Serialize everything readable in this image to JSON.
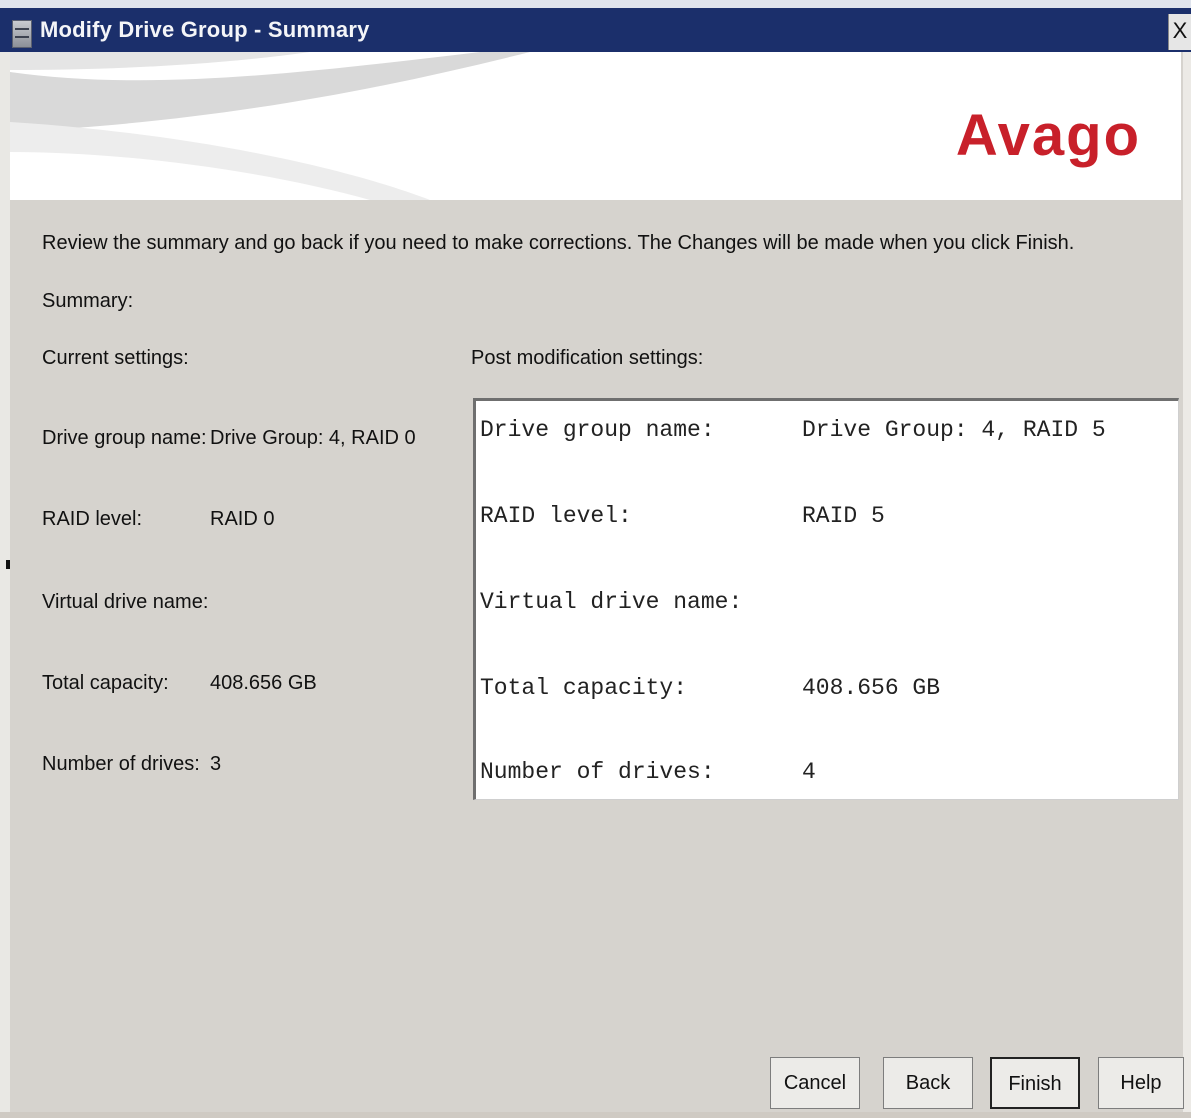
{
  "window": {
    "title": "Modify Drive Group - Summary",
    "close_label": "X"
  },
  "brand": {
    "logo_text": "Avago",
    "logo_color": "#c8202a"
  },
  "instructions": "Review the summary and go back if you need to make corrections. The Changes will be made when you click Finish.",
  "summary_label": "Summary:",
  "current": {
    "header": "Current settings:",
    "rows": [
      {
        "label": "Drive group name:",
        "value": "Drive Group: 4, RAID 0"
      },
      {
        "label": "RAID level:",
        "value": "RAID 0"
      },
      {
        "label": "Virtual drive name:",
        "value": ""
      },
      {
        "label": "Total capacity:",
        "value": "408.656 GB"
      },
      {
        "label": "Number of drives:",
        "value": "3"
      }
    ]
  },
  "post": {
    "header": "Post modification settings:",
    "rows": [
      {
        "label": "Drive group name:",
        "value": "Drive Group: 4, RAID 5"
      },
      {
        "label": "RAID level:",
        "value": "RAID 5"
      },
      {
        "label": "Virtual drive name:",
        "value": ""
      },
      {
        "label": "Total capacity:",
        "value": "408.656 GB"
      },
      {
        "label": "Number of drives:",
        "value": "4"
      }
    ]
  },
  "buttons": {
    "cancel": "Cancel",
    "back": "Back",
    "finish": "Finish",
    "help": "Help"
  },
  "icons": {
    "app": "drive-stack-icon",
    "close": "close-icon"
  }
}
